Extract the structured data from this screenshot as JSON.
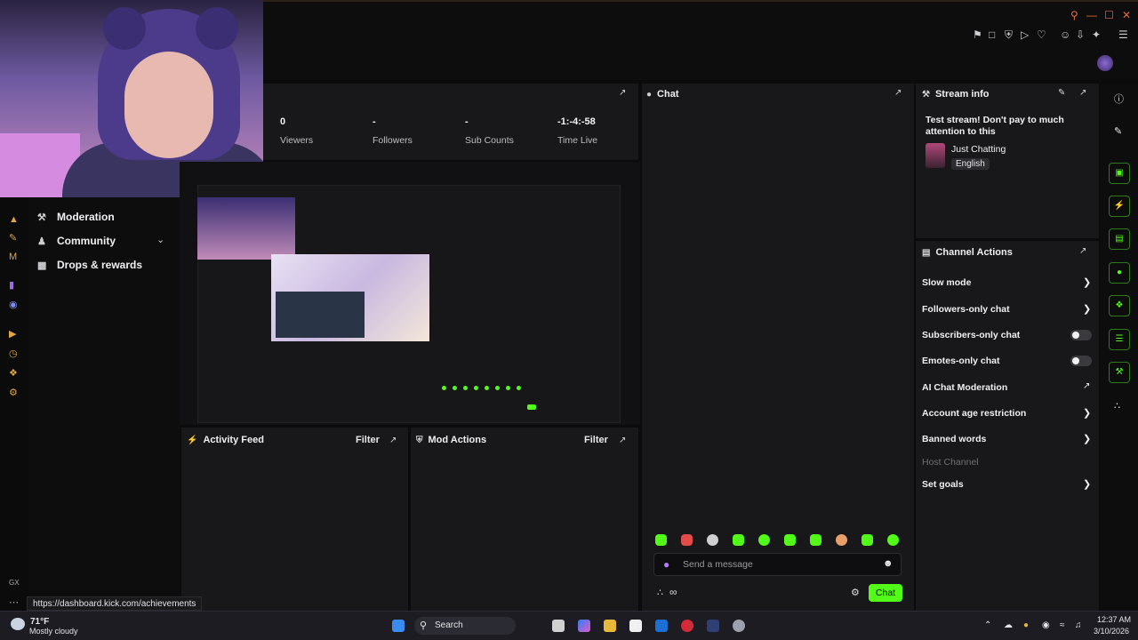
{
  "stats": [
    {
      "value": "0",
      "label": "Viewers"
    },
    {
      "value": "-",
      "label": "Followers"
    },
    {
      "value": "-",
      "label": "Sub Counts"
    },
    {
      "value": "-1:-4:-58",
      "label": "Time Live"
    }
  ],
  "nav": {
    "items": [
      {
        "label": "Moderation",
        "icon": "wrench-icon"
      },
      {
        "label": "Community",
        "icon": "people-icon"
      },
      {
        "label": "Drops & rewards",
        "icon": "gift-icon"
      }
    ]
  },
  "chat": {
    "title": "Chat",
    "placeholder": "Send a message",
    "send_label": "Chat"
  },
  "stream_info": {
    "title": "Stream info",
    "stream_title": "Test stream! Don't pay to much attention to this",
    "category": "Just Chatting",
    "language": "English"
  },
  "channel_actions": {
    "title": "Channel Actions",
    "items": [
      {
        "label": "Slow mode",
        "control": "arrow"
      },
      {
        "label": "Followers-only chat",
        "control": "arrow"
      },
      {
        "label": "Subscribers-only chat",
        "control": "toggle"
      },
      {
        "label": "Emotes-only chat",
        "control": "toggle"
      },
      {
        "label": "AI Chat Moderation",
        "control": "external"
      },
      {
        "label": "Account age restriction",
        "control": "arrow"
      },
      {
        "label": "Banned words",
        "control": "arrow"
      },
      {
        "label": "Host Channel",
        "control": "disabled"
      },
      {
        "label": "Set goals",
        "control": "arrow"
      }
    ]
  },
  "activity_feed": {
    "title": "Activity Feed",
    "filter_label": "Filter"
  },
  "mod_actions": {
    "title": "Mod Actions",
    "filter_label": "Filter"
  },
  "status_bar": {
    "url": "https://dashboard.kick.com/achievements"
  },
  "taskbar": {
    "weather_temp": "71°F",
    "weather_desc": "Mostly cloudy",
    "search_label": "Search",
    "time": "12:37 AM",
    "date": "3/10/2026"
  },
  "left_rail_labels": {
    "gx": "GX"
  },
  "colors": {
    "accent": "#53fc18",
    "panel": "#18181b",
    "background": "#0b0b0c"
  }
}
